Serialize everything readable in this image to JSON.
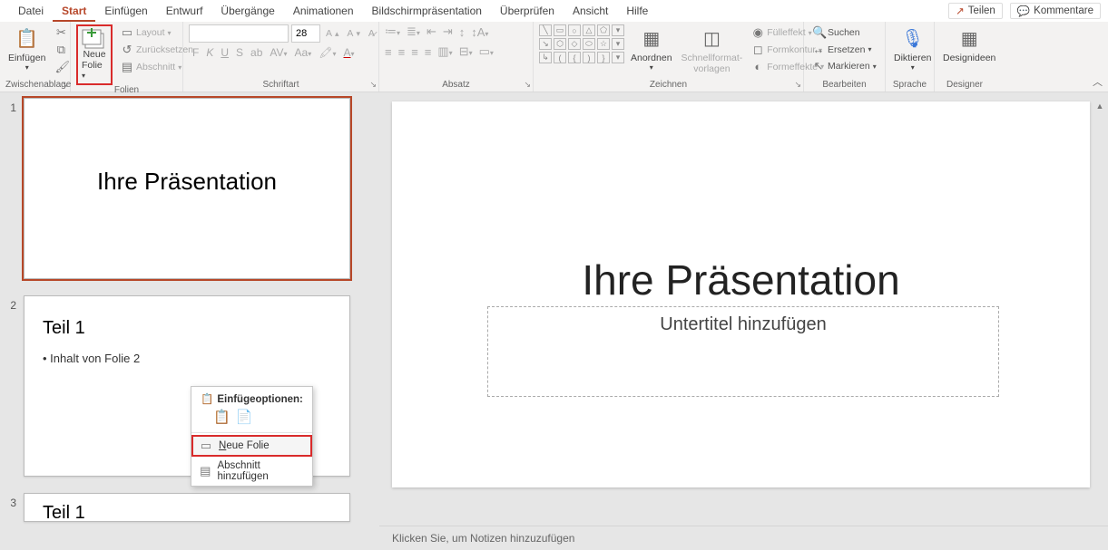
{
  "tabs": {
    "datei": "Datei",
    "start": "Start",
    "einfuegen": "Einfügen",
    "entwurf": "Entwurf",
    "uebergaenge": "Übergänge",
    "animationen": "Animationen",
    "bildschirm": "Bildschirmpräsentation",
    "ueberpruefen": "Überprüfen",
    "ansicht": "Ansicht",
    "hilfe": "Hilfe",
    "teilen": "Teilen",
    "kommentare": "Kommentare"
  },
  "ribbon": {
    "clipboard": {
      "label": "Zwischenablage",
      "paste": "Einfügen"
    },
    "slides": {
      "label": "Folien",
      "new_slide": "Neue",
      "new_slide2": "Folie",
      "layout": "Layout",
      "reset": "Zurücksetzen",
      "section": "Abschnitt"
    },
    "font": {
      "label": "Schriftart",
      "name": "",
      "size": "28"
    },
    "para": {
      "label": "Absatz"
    },
    "draw": {
      "label": "Zeichnen",
      "arrange": "Anordnen",
      "quickfmt1": "Schnellformat-",
      "quickfmt2": "vorlagen",
      "fuellung": "Fülleffekt",
      "kontur": "Formkontur",
      "effekte": "Formeffekte"
    },
    "edit": {
      "label": "Bearbeiten",
      "suchen": "Suchen",
      "ersetzen": "Ersetzen",
      "markieren": "Markieren"
    },
    "voice": {
      "label": "Sprache",
      "diktieren": "Diktieren"
    },
    "designer": {
      "label": "Designer",
      "ideen": "Designideen"
    }
  },
  "slides_panel": {
    "n1": "1",
    "n2": "2",
    "n3": "3",
    "s1_title": "Ihre Präsentation",
    "s2_title": "Teil 1",
    "s2_body": "• Inhalt von Folie 2",
    "s3_title": "Teil 1"
  },
  "canvas": {
    "title": "Ihre Präsentation",
    "subtitle": "Untertitel hinzufügen"
  },
  "notes": {
    "placeholder": "Klicken Sie, um Notizen hinzuzufügen"
  },
  "ctx": {
    "head": "Einfügeoptionen:",
    "neue_pre": "N",
    "neue_rest": "eue Folie",
    "abschnitt": "Abschnitt hinzufügen"
  }
}
